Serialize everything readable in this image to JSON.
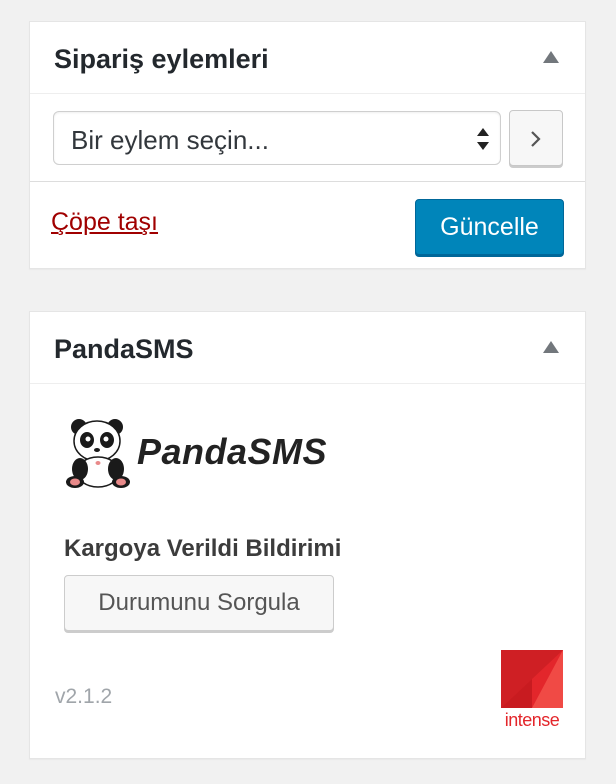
{
  "order_actions": {
    "title": "Sipariş eylemleri",
    "select_value": "Bir eylem seçin...",
    "go_icon": "chevron-right-icon",
    "trash_link": "Çöpe taşı",
    "update_button": "Güncelle"
  },
  "pandasms": {
    "title": "PandaSMS",
    "logo_text": "PandaSMS",
    "section_label": "Kargoya Verildi Bildirimi",
    "query_button": "Durumunu Sorgula",
    "version": "v2.1.2",
    "partner_logo_text": "intense"
  },
  "colors": {
    "primary_button": "#0085ba",
    "trash_link": "#a00000",
    "intense_red": "#e3262b"
  }
}
